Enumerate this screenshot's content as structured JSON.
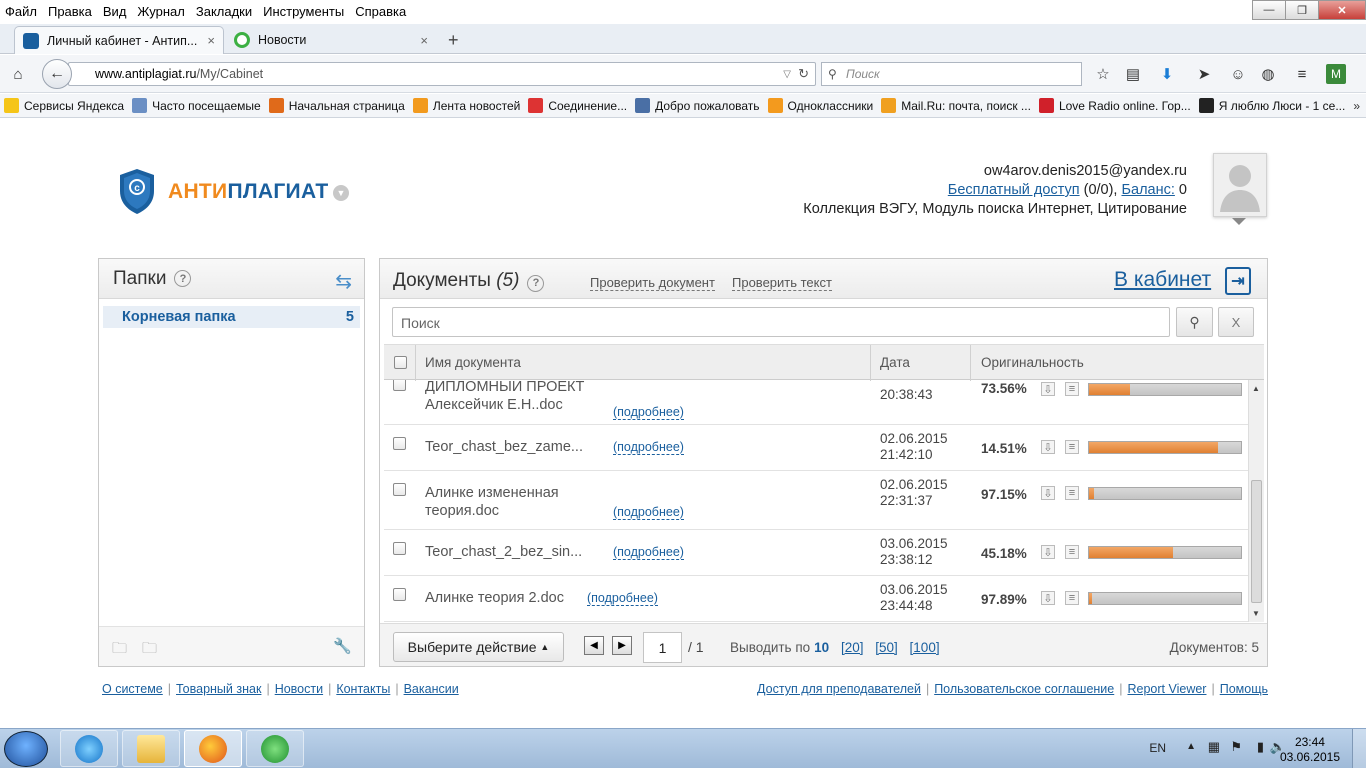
{
  "menu": [
    "Файл",
    "Правка",
    "Вид",
    "Журнал",
    "Закладки",
    "Инструменты",
    "Справка"
  ],
  "window_buttons": {
    "minimize": "—",
    "maximize": "❐",
    "close": "✕"
  },
  "tabs": [
    {
      "title": "Личный кабинет - Антип...",
      "close": "×"
    },
    {
      "title": "Новости",
      "close": "×"
    }
  ],
  "new_tab": "+",
  "url": {
    "domain": "www.antiplagiat.ru",
    "path": "/My/Cabinet"
  },
  "browser_search_placeholder": "Поиск",
  "bookmarks": [
    {
      "label": "Сервисы Яндекса",
      "color": "#f5c518"
    },
    {
      "label": "Часто посещаемые",
      "color": "#6b8fc4"
    },
    {
      "label": "Начальная страница",
      "color": "#e06a1a"
    },
    {
      "label": "Лента новостей",
      "color": "#f29a1e"
    },
    {
      "label": "Соединение...",
      "color": "#d33"
    },
    {
      "label": "Добро пожаловать",
      "color": "#4a6fa5"
    },
    {
      "label": "Одноклассники",
      "color": "#f39a1e"
    },
    {
      "label": "Mail.Ru: почта, поиск ...",
      "color": "#f0a020"
    },
    {
      "label": "Love Radio online. Гор...",
      "color": "#d0202a"
    },
    {
      "label": "Я люблю Люси - 1 се...",
      "color": "#222"
    }
  ],
  "logo": {
    "part1": "АНТИ",
    "part2": "ПЛАГИАТ"
  },
  "user": {
    "email": "ow4arov.denis2015@yandex.ru",
    "access_link": "Бесплатный доступ",
    "access_value": "(0/0),",
    "balance_link": "Баланс:",
    "balance_value": "0",
    "collections": "Коллекция ВЭГУ, Модуль поиска Интернет, Цитирование"
  },
  "folders": {
    "title": "Папки",
    "help": "?",
    "items": [
      {
        "name": "Корневая папка",
        "count": "5"
      }
    ]
  },
  "documents": {
    "title": "Документы",
    "count": "(5)",
    "help": "?",
    "check_document": "Проверить документ",
    "check_text": "Проверить текст",
    "cabinet_link": "В кабинет",
    "search_placeholder": "Поиск",
    "clear_label": "X",
    "columns": {
      "name": "Имя документа",
      "date": "Дата",
      "originality": "Оригинальность"
    },
    "more_label": "(подробнее)",
    "rows": [
      {
        "name1": "ДИПЛОМНЫЙ ПРОЕКТ",
        "name2": "Алексейчик Е.Н..doc",
        "date": "",
        "time": "20:38:43",
        "pct": "73.56%",
        "fill": 0.27
      },
      {
        "name1": "Teor_chast_bez_zame...",
        "name2": "",
        "date": "02.06.2015",
        "time": "21:42:10",
        "pct": "14.51%",
        "fill": 0.85
      },
      {
        "name1": "Алинке измененная",
        "name2": "теория.doc",
        "date": "02.06.2015",
        "time": "22:31:37",
        "pct": "97.15%",
        "fill": 0.03
      },
      {
        "name1": "Teor_chast_2_bez_sin...",
        "name2": "",
        "date": "03.06.2015",
        "time": "23:38:12",
        "pct": "45.18%",
        "fill": 0.55
      },
      {
        "name1": "Алинке теория 2.doc",
        "name2": "",
        "date": "03.06.2015",
        "time": "23:44:48",
        "pct": "97.89%",
        "fill": 0.02
      }
    ],
    "action_button": "Выберите действие",
    "page_current": "1",
    "page_total": "/ 1",
    "per_page_label": "Выводить по",
    "per_page_current": "10",
    "per_page_options": [
      "[20]",
      "[50]",
      "[100]"
    ],
    "doc_count": "Документов: 5"
  },
  "footer_left": [
    "О системе",
    "Товарный знак",
    "Новости",
    "Контакты",
    "Вакансии"
  ],
  "footer_right": [
    "Доступ для преподавателей",
    "Пользовательское соглашение",
    "Report Viewer",
    "Помощь"
  ],
  "taskbar": {
    "lang": "EN",
    "time": "23:44",
    "date": "03.06.2015"
  },
  "colors": {
    "brand_blue": "#1a5f9e",
    "brand_orange": "#f08a1e",
    "bar_fill": "#e8873a"
  }
}
